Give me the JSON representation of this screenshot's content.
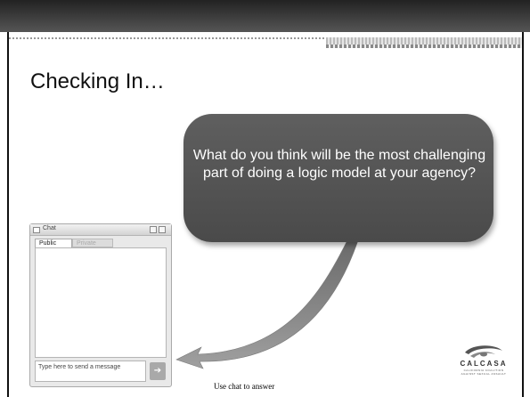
{
  "slide": {
    "title": "Checking In…",
    "question": "What do you think will be the most challenging part of doing a logic model at your agency?",
    "caption": "Use chat to answer"
  },
  "chat_window": {
    "title": "Chat",
    "tabs": [
      {
        "label": "Public",
        "selected": true
      },
      {
        "label": "Private",
        "selected": false
      }
    ],
    "input_placeholder": "Type here to send a message",
    "send_icon": "arrow-right-icon"
  },
  "logo": {
    "name": "CALCASA",
    "subtitle": "CALIFORNIA COALITION AGAINST SEXUAL ASSAULT"
  },
  "colors": {
    "bubble": "#555555",
    "top_bar": "#333333",
    "arrow": "#8a8a8a"
  }
}
